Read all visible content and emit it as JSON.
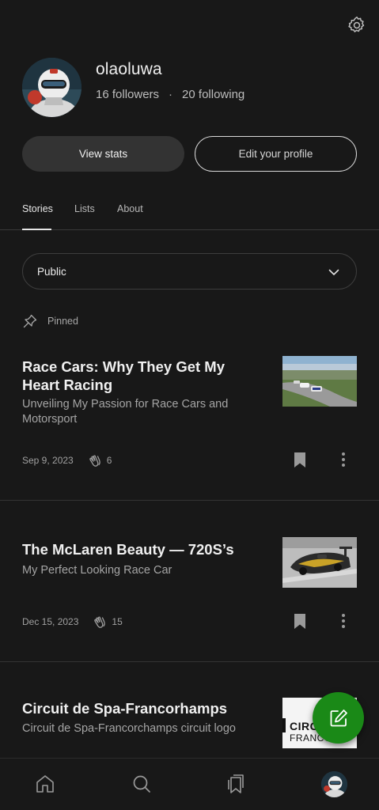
{
  "profile": {
    "username": "olaoluwa",
    "followers": "16 followers",
    "separator": "·",
    "following": "20 following"
  },
  "actions": {
    "view_stats": "View stats",
    "edit_profile": "Edit your profile"
  },
  "tabs": [
    {
      "label": "Stories",
      "active": true
    },
    {
      "label": "Lists",
      "active": false
    },
    {
      "label": "About",
      "active": false
    }
  ],
  "filter": {
    "selected": "Public"
  },
  "pinned_label": "Pinned",
  "stories": [
    {
      "title": "Race Cars: Why They Get My Heart Racing",
      "subtitle": "Unveiling My Passion for Race Cars and Motorsport",
      "date": "Sep 9, 2023",
      "claps": "6"
    },
    {
      "title": "The McLaren Beauty — 720S’s",
      "subtitle": "My Perfect Looking Race Car",
      "date": "Dec 15, 2023",
      "claps": "15"
    },
    {
      "title": "Circuit de Spa-Francorhamps",
      "subtitle": "Circuit de Spa-Francorchamps circuit logo",
      "thumb_text_1": "CIRC",
      "thumb_text_2": "FRANCO"
    }
  ],
  "nav": [
    "home-icon",
    "search-icon",
    "bookmarks-icon",
    "profile-avatar"
  ],
  "colors": {
    "accent": "#1a8917",
    "background": "#181818"
  }
}
